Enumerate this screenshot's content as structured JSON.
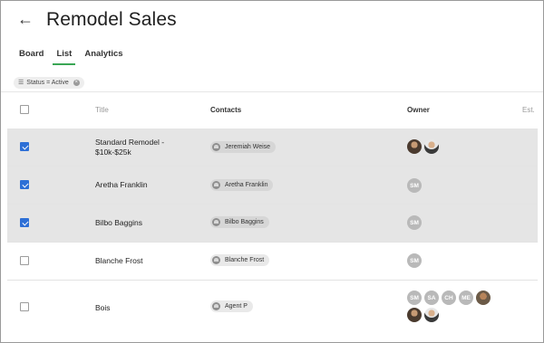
{
  "header": {
    "back_icon": "arrow-left-icon",
    "title": "Remodel Sales"
  },
  "tabs": [
    {
      "label": "Board",
      "active": false
    },
    {
      "label": "List",
      "active": true
    },
    {
      "label": "Analytics",
      "active": false
    }
  ],
  "filter": {
    "label": "Status = Active",
    "icon": "filter-icon",
    "clear_icon": "close-icon"
  },
  "columns": {
    "title": "Title",
    "contacts": "Contacts",
    "owner": "Owner",
    "est": "Est."
  },
  "rows": [
    {
      "title_line1": "Standard Remodel -",
      "title_line2": "$10k-$25k",
      "contact": "Jeremiah Weise",
      "selected": true,
      "owners": [
        {
          "type": "photo",
          "style": "photo1"
        },
        {
          "type": "photo",
          "style": "photo2"
        }
      ]
    },
    {
      "title_line1": "Aretha Franklin",
      "contact": "Aretha Franklin",
      "selected": true,
      "owners": [
        {
          "type": "initials",
          "text": "SM"
        }
      ]
    },
    {
      "title_line1": "Bilbo Baggins",
      "contact": "Bilbo Baggins",
      "selected": true,
      "owners": [
        {
          "type": "initials",
          "text": "SM"
        }
      ]
    },
    {
      "title_line1": "Blanche Frost",
      "contact": "Blanche Frost",
      "selected": false,
      "owners": [
        {
          "type": "initials",
          "text": "SM"
        }
      ]
    },
    {
      "title_line1": "Bois",
      "contact": "Agent P",
      "selected": false,
      "owners": [
        {
          "type": "initials",
          "text": "SM"
        },
        {
          "type": "initials",
          "text": "SA"
        },
        {
          "type": "initials",
          "text": "CH"
        },
        {
          "type": "initials",
          "text": "ME"
        },
        {
          "type": "photo",
          "style": "photo3"
        },
        {
          "type": "photo",
          "style": "photo1"
        },
        {
          "type": "photo",
          "style": "photo2"
        }
      ]
    }
  ],
  "colors": {
    "accent": "#3aa655",
    "checkbox": "#2d6fd6",
    "selected_row": "#e5e5e5"
  }
}
